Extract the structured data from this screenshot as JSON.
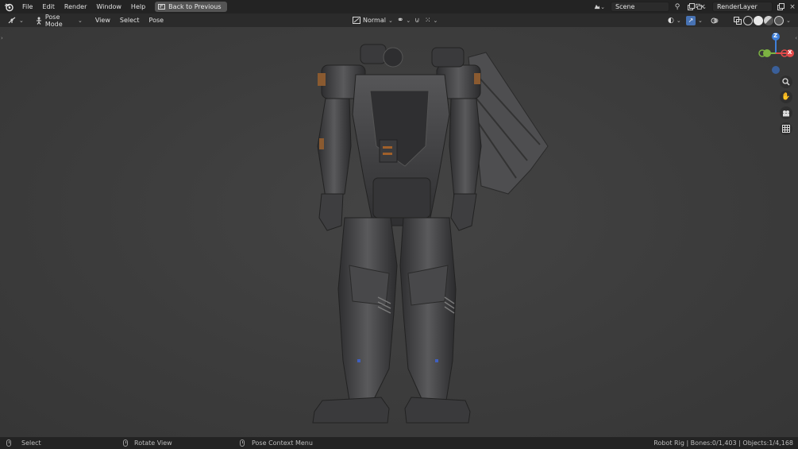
{
  "topbar": {
    "menus": [
      "File",
      "Edit",
      "Render",
      "Window",
      "Help"
    ],
    "back_button": "Back to Previous",
    "scene_name": "Scene",
    "render_layer": "RenderLayer"
  },
  "header": {
    "mode": "Pose Mode",
    "menus": [
      "View",
      "Select",
      "Pose"
    ],
    "transform_orientation": "Normal"
  },
  "gizmo": {
    "z": "Z",
    "x": "X"
  },
  "statusbar": {
    "select": "Select",
    "rotate": "Rotate View",
    "context": "Pose Context Menu",
    "stats": "Robot Rig | Bones:0/1,403 | Objects:1/4,168"
  },
  "colors": {
    "x_axis": "#e24a4a",
    "y_axis": "#7cb342",
    "z_axis": "#3f7fd9",
    "active_button": "#4772b3"
  }
}
